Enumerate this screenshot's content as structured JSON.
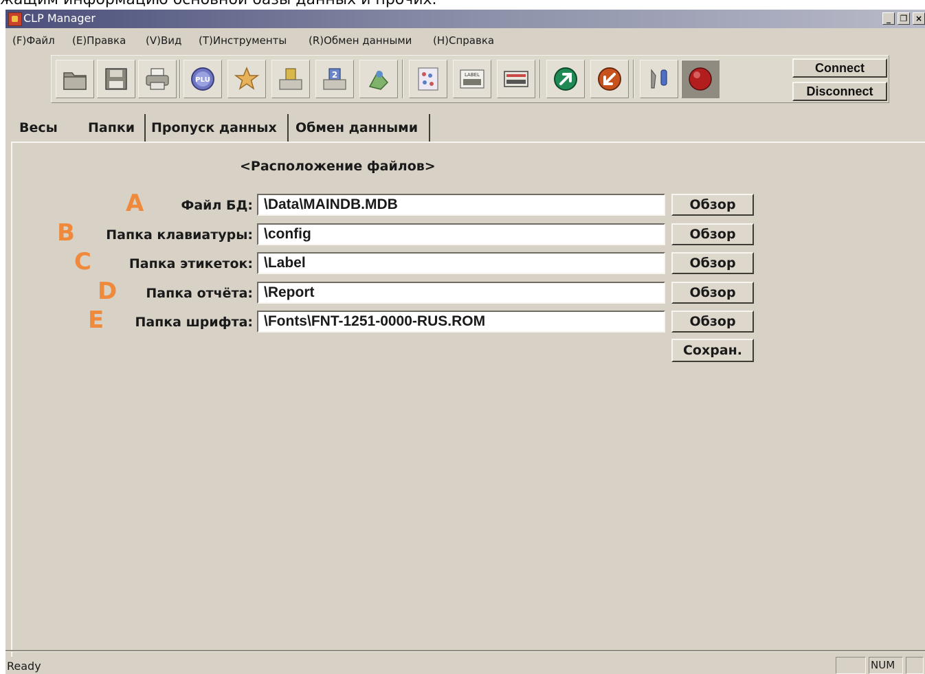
{
  "caption": "жащим информацию основной базы данных и прочих.",
  "window": {
    "title": "CLP Manager"
  },
  "menu": [
    "(F)Файл",
    "(E)Правка",
    "(V)Вид",
    "(T)Инструменты",
    "(R)Обмен данными",
    "(H)Справка"
  ],
  "toolbar": {
    "icons": [
      "folder-icon",
      "save-icon",
      "print-icon",
      "plu-icon",
      "star-icon",
      "scale-icon",
      "scale-2-icon",
      "keyboard-icon",
      "list-icon",
      "label-icon",
      "store-icon",
      "arrow-up-right-icon",
      "arrow-down-left-icon",
      "settings-icon",
      "record-icon"
    ],
    "plu_label": "PLU",
    "label_label": "LABEL",
    "connect": "Connect",
    "disconnect": "Disconnect"
  },
  "tabs": [
    "Весы",
    "Папки",
    "Пропуск данных",
    "Обмен данными"
  ],
  "section_title": "<Расположение файлов>",
  "rows": [
    {
      "letter": "A",
      "label": "Файл БД:",
      "value": "\\Data\\MAINDB.MDB",
      "button": "Обзор"
    },
    {
      "letter": "B",
      "label": "Папка клавиатуры:",
      "value": "\\config",
      "button": "Обзор"
    },
    {
      "letter": "C",
      "label": "Папка этикеток:",
      "value": "\\Label",
      "button": "Обзор"
    },
    {
      "letter": "D",
      "label": "Папка отчёта:",
      "value": "\\Report",
      "button": "Обзор"
    },
    {
      "letter": "E",
      "label": "Папка шрифта:",
      "value": "\\Fonts\\FNT-1251-0000-RUS.ROM",
      "button": "Обзор"
    }
  ],
  "save_button": "Сохран.",
  "status": {
    "text": "Ready",
    "num": "NUM"
  },
  "colors": {
    "annotation": "#ef8a3c",
    "panel": "#d7d2c5",
    "titlebar": "#4a4e7a"
  }
}
